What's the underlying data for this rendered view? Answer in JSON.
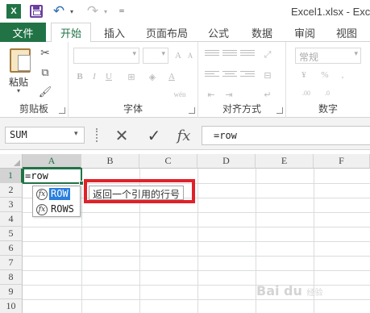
{
  "titlebar": {
    "doc_title": "Excel1.xlsx - Exce",
    "app_logo": "X",
    "undo_icon": "↶",
    "redo_icon": "↷",
    "dropdown_glyph": "▾",
    "more_glyph": "="
  },
  "tabs": {
    "file": "文件",
    "items": [
      "开始",
      "插入",
      "页面布局",
      "公式",
      "数据",
      "审阅",
      "视图"
    ],
    "active_index": 0
  },
  "ribbon": {
    "clipboard": {
      "label": "剪贴板",
      "paste_label": "粘贴"
    },
    "font": {
      "label": "字体"
    },
    "alignment": {
      "label": "对齐方式"
    },
    "number": {
      "label": "数字",
      "format_value": "常规",
      "percent_glyph": "%"
    },
    "wen_label": "wén"
  },
  "formula_bar": {
    "name_box": "SUM",
    "cancel_icon": "✕",
    "enter_icon": "✓",
    "fx_icon": "fx",
    "formula": "=row"
  },
  "grid": {
    "columns": [
      "A",
      "B",
      "C",
      "D",
      "E",
      "F"
    ],
    "rows": [
      "1",
      "2",
      "3",
      "4",
      "5",
      "6",
      "7",
      "8",
      "9",
      "10"
    ],
    "active_cell": {
      "address": "A1",
      "value": "=row"
    }
  },
  "autocomplete": {
    "fn_icon": "fx",
    "items": [
      "ROW",
      "ROWS"
    ],
    "selected_index": 0,
    "tooltip": "返回一个引用的行号"
  },
  "watermark": {
    "main": "Bai du",
    "sub": "经验"
  },
  "colors": {
    "excel_green": "#217346",
    "highlight_red": "#e0212a",
    "selection_blue": "#2a7fdd"
  }
}
